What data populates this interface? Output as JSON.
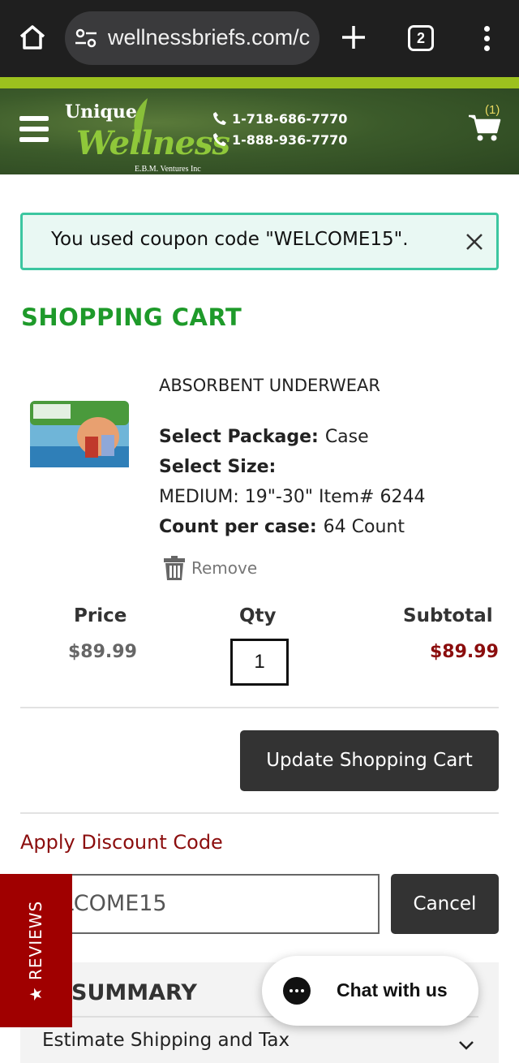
{
  "browser": {
    "url": "wellnessbriefs.com/c",
    "tab_count": "2"
  },
  "header": {
    "logo_top": "Unique",
    "logo_main": "Wellness",
    "logo_sub": "E.B.M. Ventures Inc",
    "phones": [
      "1-718-686-7770",
      "1-888-936-7770"
    ],
    "cart_count": "(1)"
  },
  "notice": {
    "message": "You used coupon code \"WELCOME15\"."
  },
  "page_title": "SHOPPING CART",
  "item": {
    "name": "ABSORBENT UNDERWEAR",
    "package_label": "Select Package:",
    "package_value": "Case",
    "size_label": "Select Size:",
    "size_value": "MEDIUM: 19\"-30\" Item# 6244",
    "count_label": "Count per case:",
    "count_value": "64 Count",
    "remove_label": "Remove",
    "price": "$89.99",
    "qty": "1",
    "subtotal": "$89.99"
  },
  "columns": {
    "price": "Price",
    "qty": "Qty",
    "subtotal": "Subtotal"
  },
  "actions": {
    "update_cart": "Update Shopping Cart",
    "discount_label": "Apply Discount Code",
    "discount_value": "WELCOME15",
    "cancel": "Cancel"
  },
  "summary": {
    "title": "SUMMARY",
    "estimate": "Estimate Shipping and Tax"
  },
  "reviews_tab": "★ REVIEWS",
  "chat": {
    "label": "Chat with us"
  },
  "colors": {
    "title_green": "#1e9a2a",
    "dark_red": "#8b0d0d",
    "notice_border": "#3cc6a0",
    "reviews_red": "#a00000"
  }
}
